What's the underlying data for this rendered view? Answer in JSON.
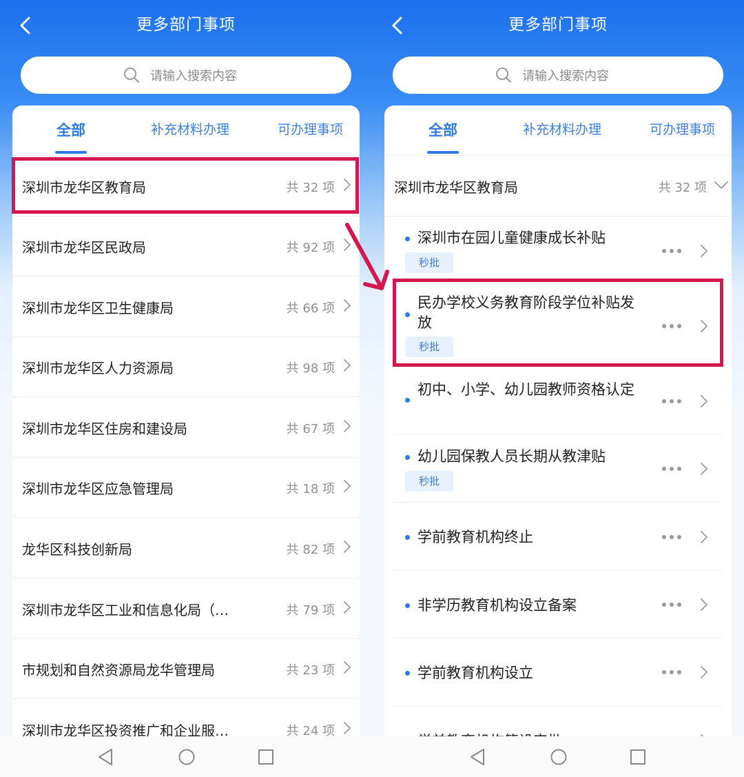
{
  "header": {
    "title": "更多部门事项"
  },
  "search": {
    "placeholder": "请输入搜索内容"
  },
  "tabs": [
    "全部",
    "补充材料办理",
    "可办理事项"
  ],
  "left": {
    "departments": [
      {
        "name": "深圳市龙华区教育局",
        "count": "共 32 项"
      },
      {
        "name": "深圳市龙华区民政局",
        "count": "共 92 项"
      },
      {
        "name": "深圳市龙华区卫生健康局",
        "count": "共 66 项"
      },
      {
        "name": "深圳市龙华区人力资源局",
        "count": "共 98 项"
      },
      {
        "name": "深圳市龙华区住房和建设局",
        "count": "共 67 项"
      },
      {
        "name": "深圳市龙华区应急管理局",
        "count": "共 18 项"
      },
      {
        "name": "龙华区科技创新局",
        "count": "共 82 项"
      },
      {
        "name": "深圳市龙华区工业和信息化局（…",
        "count": "共 79 项"
      },
      {
        "name": "市规划和自然资源局龙华管理局",
        "count": "共 23 项"
      },
      {
        "name": "深圳市龙华区投资推广和企业服…",
        "count": "共 24 项"
      }
    ]
  },
  "right": {
    "department": {
      "name": "深圳市龙华区教育局",
      "count": "共 32 项"
    },
    "items": [
      {
        "title": "深圳市在园儿童健康成长补贴",
        "badge": "秒批"
      },
      {
        "title": "民办学校义务教育阶段学位补贴发放",
        "badge": "秒批"
      },
      {
        "title": "初中、小学、幼儿园教师资格认定"
      },
      {
        "title": "幼儿园保教人员长期从教津贴",
        "badge": "秒批"
      },
      {
        "title": "学前教育机构终止"
      },
      {
        "title": "非学历教育机构设立备案"
      },
      {
        "title": "学前教育机构设立"
      },
      {
        "title": "学前教育机构筹设审批"
      }
    ]
  },
  "colors": {
    "brand": "#1b70ee",
    "highlight": "#d4184f",
    "badge_bg": "#e6f1fd"
  },
  "icons": [
    "back-icon",
    "search-icon",
    "chevron-right-icon",
    "chevron-down-icon",
    "more-icon",
    "nav-back-icon",
    "nav-home-icon",
    "nav-recent-icon"
  ]
}
